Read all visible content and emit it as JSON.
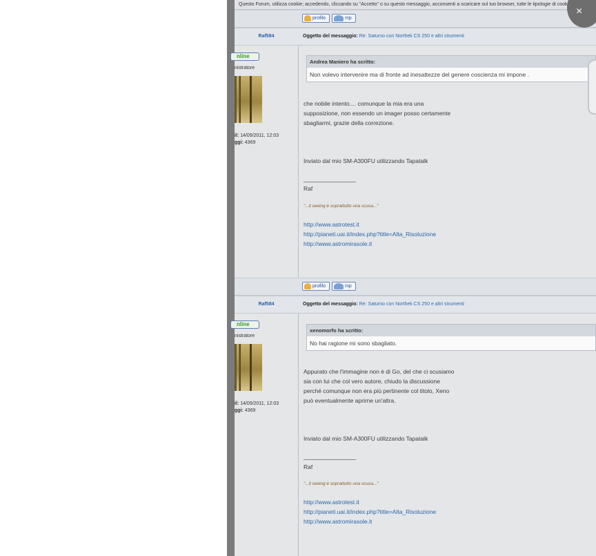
{
  "cookie_notice": "Questo Forum, utilizza cookie; accedendo, cliccando su \"Accetto\" o su questo messaggio, acconsenti a scaricare sul tuo browser, tutte le tipologie di cookie",
  "close_glyph": "×",
  "buttons": {
    "profile": "profilo",
    "pm": "mp"
  },
  "subject_label": "Oggetto del messaggio:",
  "posts": [
    {
      "author": "Raf584",
      "subject": "Re: Saturno con Northek CS 250 e altri strumenti",
      "status": "nline",
      "role": "nistratore",
      "registered_label": "il:",
      "registered_value": "14/09/2011, 12:03",
      "posts_label": "ggi:",
      "posts_value": "4369",
      "quote_header": "Andrea Maniero ha scritto:",
      "quote_body": "Non volevo intervenire ma di fronte ad inesattezze del genere coscienza mi impone .",
      "body": [
        "che nobile intento.... comunque la mia era una",
        "supposizione, non essendo un imager posso certamente",
        "sbagliarmi, grazie della correzione."
      ],
      "sent_from": "Inviato dal mio SM-A300FU utilizzando Tapatalk",
      "signature": "Raf",
      "motto": "\"...il seeing è soprattutto una scusa...\"",
      "links": [
        "http://www.astrotest.it",
        "http://pianeti.uai.it/index.php?title=Alta_Risoluzione",
        "http://www.astromirasole.it"
      ]
    },
    {
      "author": "Raf584",
      "subject": "Re: Saturno con Northek CS 250 e altri strumenti",
      "status": "nline",
      "role": "nistratore",
      "registered_label": "il:",
      "registered_value": "14/09/2011, 12:03",
      "posts_label": "ggi:",
      "posts_value": "4369",
      "quote_header": "xenomorfo ha scritto:",
      "quote_body": "No hai ragione mi sono sbagliato.",
      "body": [
        "Appurato che l'immagine non è di Go, del che ci scusiamo",
        "sia con lui che col vero autore, chiudo la discussione",
        "perché comunque non era più pertinente col titolo, Xeno",
        "può eventualmente aprirne un'altra."
      ],
      "sent_from": "Inviato dal mio SM-A300FU utilizzando Tapatalk",
      "signature": "Raf",
      "motto": "\"...il seeing è soprattutto una scusa...\"",
      "links": [
        "http://www.astrotest.it",
        "http://pianeti.uai.it/index.php?title=Alta_Risoluzione",
        "http://www.astromirasole.it"
      ]
    }
  ]
}
